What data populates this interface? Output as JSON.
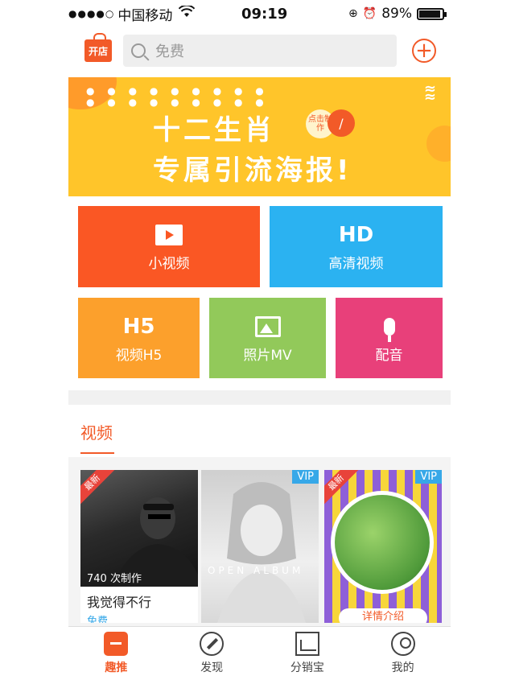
{
  "status_bar": {
    "signal": "●●●●○",
    "carrier": "中国移动",
    "time": "09:19",
    "battery": "89%",
    "battery_level": 0.89
  },
  "topbar": {
    "shop_label": "开店",
    "search_placeholder": "免费"
  },
  "banner": {
    "line1": "十二生肖",
    "line2": "专属引流海报!",
    "badge": "点击制作"
  },
  "tiles": [
    {
      "icon": "video-icon",
      "label": "小视频",
      "color": "#fa5724"
    },
    {
      "icon": "hd-icon",
      "icon_text": "HD",
      "label": "高清视频",
      "color": "#2bb2f1"
    },
    {
      "icon": "h5-icon",
      "icon_text": "H5",
      "label": "视频H5",
      "color": "#fca02c"
    },
    {
      "icon": "photo-icon",
      "label": "照片MV",
      "color": "#92c95a"
    },
    {
      "icon": "mic-icon",
      "label": "配音",
      "color": "#e8407a"
    }
  ],
  "section": {
    "title": "视频"
  },
  "cards": [
    {
      "ribbon": "最新",
      "count": "740 次制作",
      "title": "我觉得不行",
      "price": "免费"
    },
    {
      "vip": "VIP",
      "overlay": "OPEN ALBUM"
    },
    {
      "ribbon": "最新",
      "vip": "VIP",
      "caption": "详情介绍"
    }
  ],
  "tabbar": [
    {
      "label": "趣推",
      "icon": "home-icon",
      "active": true
    },
    {
      "label": "发现",
      "icon": "compass-icon"
    },
    {
      "label": "分销宝",
      "icon": "chart-icon"
    },
    {
      "label": "我的",
      "icon": "user-icon"
    }
  ],
  "colors": {
    "accent": "#f25a28",
    "banner": "#ffc52a",
    "vip": "#37a8e8"
  }
}
